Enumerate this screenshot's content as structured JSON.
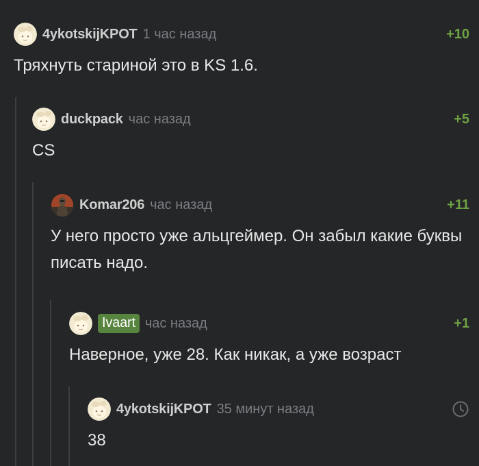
{
  "comments": [
    {
      "username": "4ykotskijKPOT",
      "time": "1 час назад",
      "rating": "+10",
      "text": "Тряхнуть стариной это в KS 1.6.",
      "avatar": "pale-avatar"
    },
    {
      "username": "duckpack",
      "time": "час назад",
      "rating": "+5",
      "text": "CS",
      "avatar": "pale-avatar"
    },
    {
      "username": "Komar206",
      "time": "час назад",
      "rating": "+11",
      "text": "У него просто уже альцгеймер. Он забыл какие буквы писать надо.",
      "avatar": "soldier-avatar"
    },
    {
      "username": "Ivaart",
      "time": "час назад",
      "rating": "+1",
      "text": "Наверное, уже 28. Как никак, а уже возраст",
      "avatar": "pale-avatar",
      "author_badge_color": "#57843e"
    },
    {
      "username": "4ykotskijKPOT",
      "time": "35 минут назад",
      "rating_icon": "clock-icon",
      "text": "38",
      "avatar": "pale-avatar"
    }
  ],
  "colors": {
    "background": "#242628",
    "rating_positive": "#6fa244",
    "thread_line": "#3b3e42",
    "username": "#cfcfcf",
    "timestamp": "#7a7d82"
  }
}
